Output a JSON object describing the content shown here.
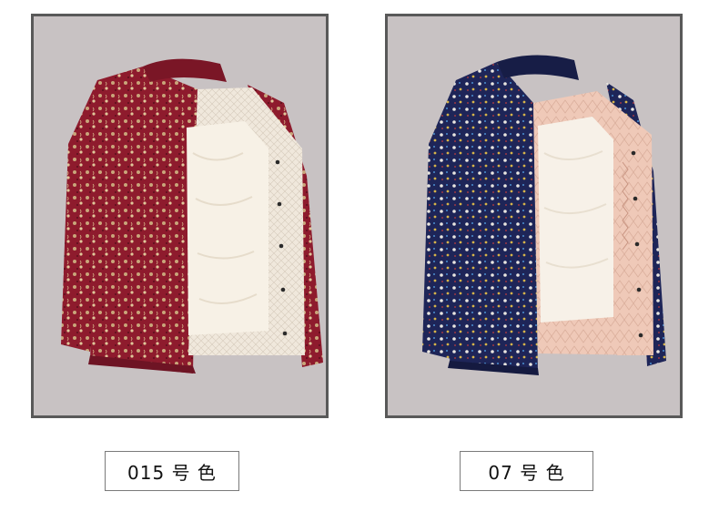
{
  "products": [
    {
      "label": "015 号 色",
      "colors": {
        "shell": "#8e1b2d",
        "pattern": "#c8a77a",
        "lining": "#f3ece2",
        "collar": "#7a1626"
      }
    },
    {
      "label": "07 号 色",
      "colors": {
        "shell": "#1e2558",
        "pattern": "#e9e6e0",
        "lining": "#efc9b8",
        "collar": "#171d46"
      }
    }
  ],
  "background": "#c8c2c3",
  "frame_border": "#595959"
}
